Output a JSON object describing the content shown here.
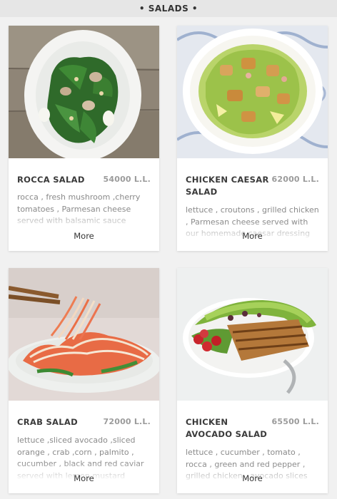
{
  "header": {
    "title": "• SALADS •"
  },
  "items": [
    {
      "name": "ROCCA SALAD",
      "price": "54000 L.L.",
      "description": "rocca , fresh mushroom ,cherry tomatoes , Parmesan cheese served with balsamic sauce",
      "more_label": "More",
      "photo_icon": "rocca-salad-photo"
    },
    {
      "name": "CHICKEN CAESAR SALAD",
      "price": "62000 L.L.",
      "description": "lettuce , croutons , grilled chicken , Parmesan cheese served with our homemade caesar dressing",
      "more_label": "More",
      "photo_icon": "chicken-caesar-salad-photo"
    },
    {
      "name": "CRAB SALAD",
      "price": "72000 L.L.",
      "description": "lettuce ,sliced avocado ,sliced orange , crab ,corn , palmito , cucumber , black and red caviar served with lemon mustard",
      "more_label": "More",
      "photo_icon": "crab-salad-photo"
    },
    {
      "name": "CHICKEN AVOCADO SALAD",
      "price": "65500 L.L.",
      "description": "lettuce , cucumber , tomato , rocca , green and red pepper , grilled chicken , avocado slices",
      "more_label": "More",
      "photo_icon": "chicken-avocado-salad-photo"
    }
  ],
  "colors": {
    "page_background": "#f1f1f1",
    "card_background": "#ffffff",
    "title_text": "#3a3a3a",
    "price_text": "#9b9b9b",
    "description_text": "#8a8a8a"
  }
}
